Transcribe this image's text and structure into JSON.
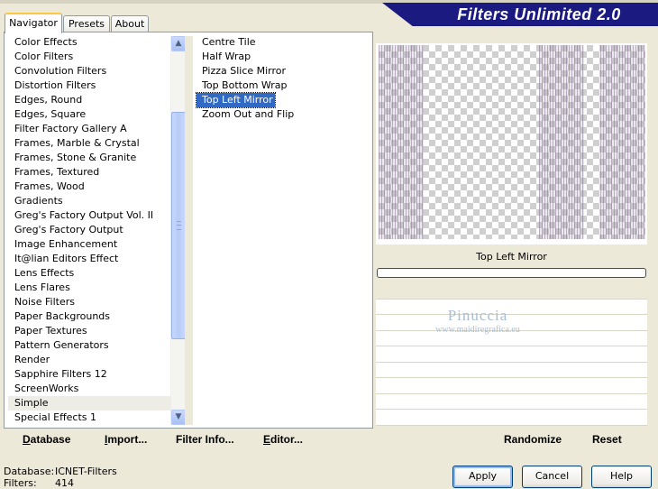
{
  "window": {
    "title": "Filters Unlimited 2.0"
  },
  "tabs": [
    {
      "label": "Navigator",
      "active": true
    },
    {
      "label": "Presets",
      "active": false
    },
    {
      "label": "About",
      "active": false
    }
  ],
  "categories": [
    "Color Effects",
    "Color Filters",
    "Convolution Filters",
    "Distortion Filters",
    "Edges, Round",
    "Edges, Square",
    "Filter Factory Gallery A",
    "Frames, Marble & Crystal",
    "Frames, Stone & Granite",
    "Frames, Textured",
    "Frames, Wood",
    "Gradients",
    "Greg's Factory Output Vol. II",
    "Greg's Factory Output",
    "Image Enhancement",
    "It@lian Editors Effect",
    "Lens Effects",
    "Lens Flares",
    "Noise Filters",
    "Paper Backgrounds",
    "Paper Textures",
    "Pattern Generators",
    "Render",
    "Sapphire Filters 12",
    "ScreenWorks",
    "Simple",
    "Special Effects 1"
  ],
  "selected_category": "Simple",
  "filters": [
    "Centre Tile",
    "Half Wrap",
    "Pizza Slice Mirror",
    "Top Bottom Wrap",
    "Top Left Mirror",
    "Zoom Out and Flip"
  ],
  "selected_filter": "Top Left Mirror",
  "scrollbar": {
    "up_icon": "chevron-up-icon",
    "down_icon": "chevron-down-icon",
    "up_glyph": "▲",
    "down_glyph": "▼"
  },
  "left_buttons": {
    "database": {
      "u": "D",
      "rest": "atabase"
    },
    "import": {
      "u": "I",
      "rest": "mport..."
    },
    "filter_info": {
      "u": "Filter I",
      "rest": "nfo..."
    },
    "editor": {
      "u": "E",
      "rest": "ditor..."
    }
  },
  "right_buttons": {
    "randomize": "Randomize",
    "reset": "Reset"
  },
  "preview": {
    "filter_name": "Top Left Mirror"
  },
  "watermark": {
    "line1": "Pinuccia",
    "line2": "www.maidiregrafica.eu"
  },
  "info": {
    "database_label": "Database:",
    "database_value": "ICNET-Filters",
    "filters_label": "Filters:",
    "filters_value": "414"
  },
  "dialog_buttons": {
    "apply": "Apply",
    "cancel": "Cancel",
    "help": "Help"
  }
}
